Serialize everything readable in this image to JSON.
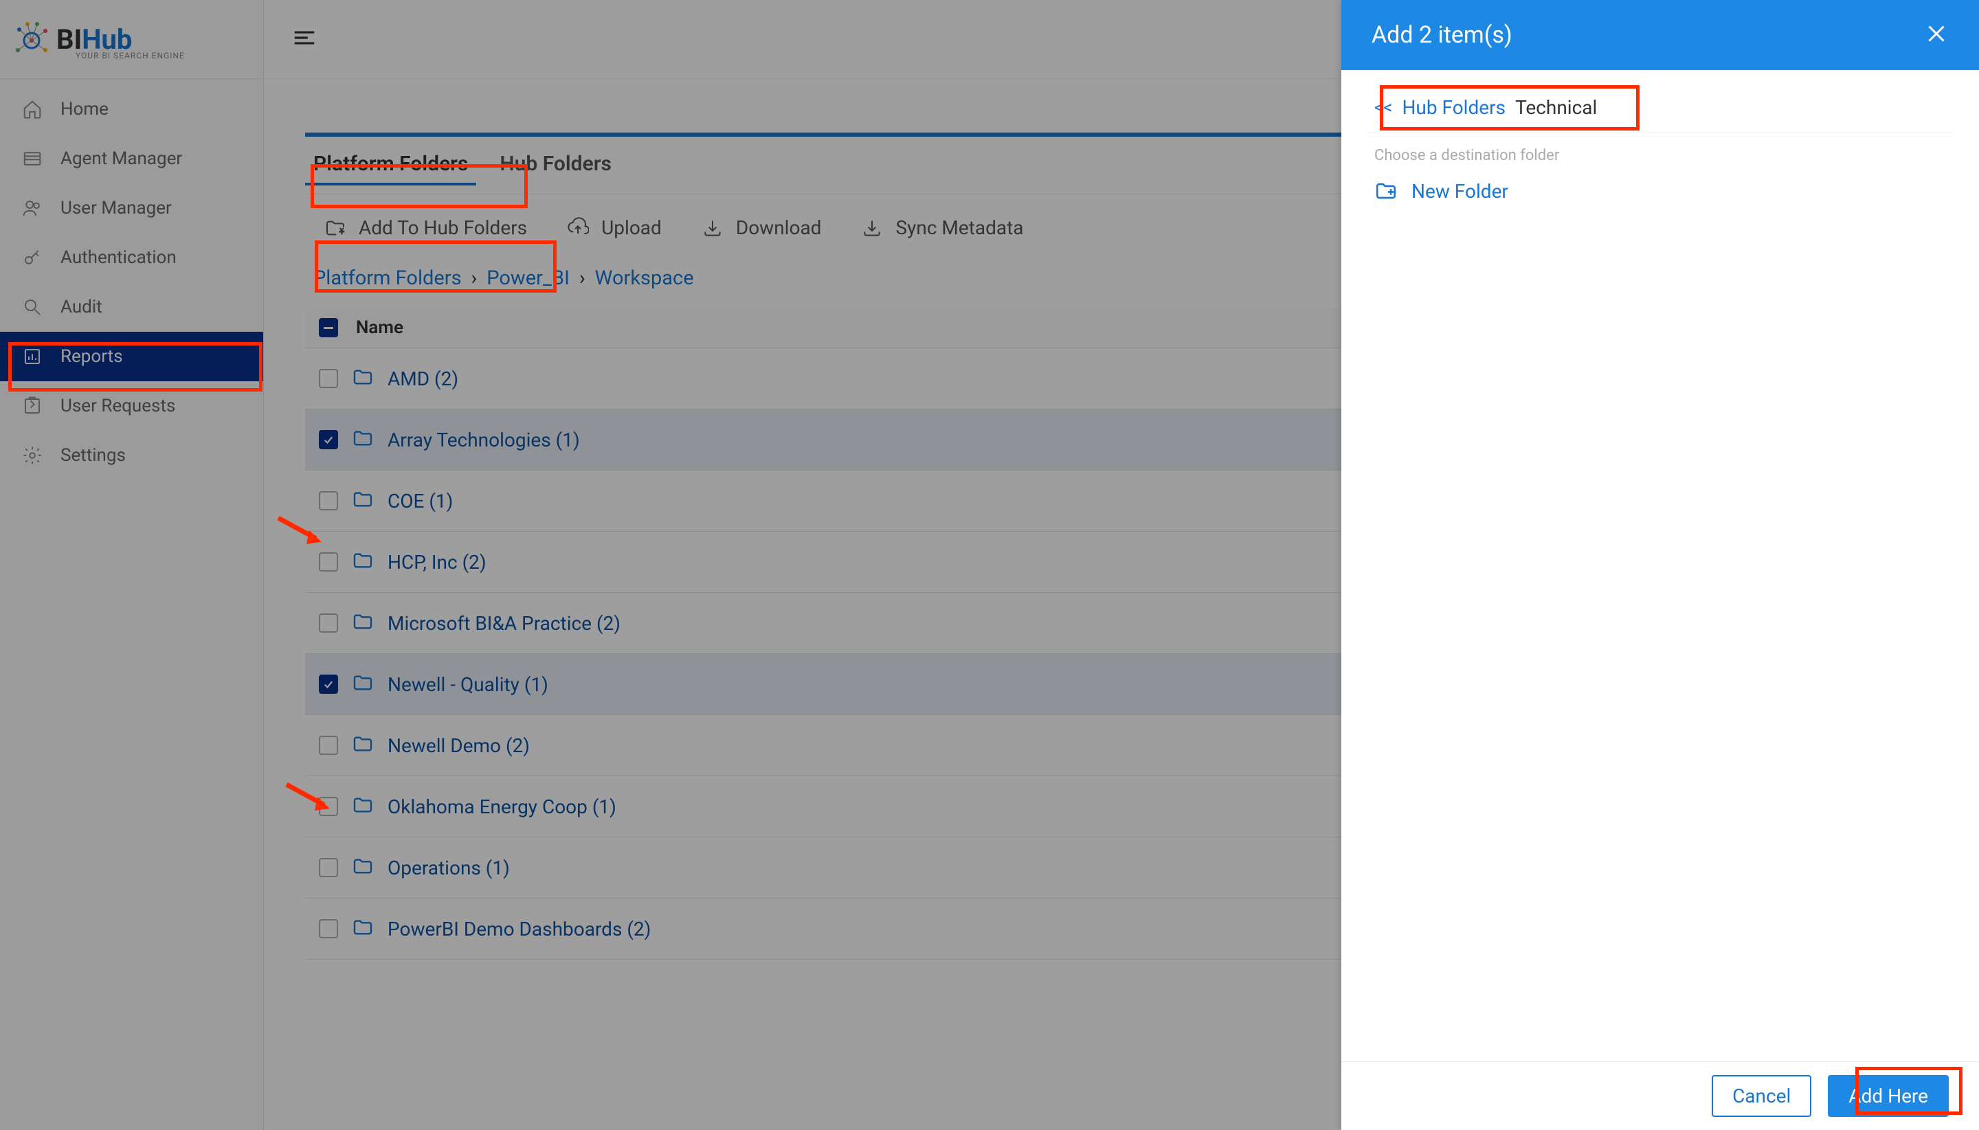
{
  "logo": {
    "bi": "BI",
    "hub": "Hub",
    "sub": "YOUR BI SEARCH ENGINE"
  },
  "sidebar": {
    "items": [
      {
        "label": "Home"
      },
      {
        "label": "Agent Manager"
      },
      {
        "label": "User Manager"
      },
      {
        "label": "Authentication"
      },
      {
        "label": "Audit"
      },
      {
        "label": "Reports"
      },
      {
        "label": "User Requests"
      },
      {
        "label": "Settings"
      }
    ]
  },
  "tabs": {
    "platform": "Platform Folders",
    "hub": "Hub Folders"
  },
  "actions": {
    "add": "Add To Hub Folders",
    "upload": "Upload",
    "download": "Download",
    "sync": "Sync Metadata"
  },
  "breadcrumbs": {
    "a": "Platform Folders",
    "b": "Power_BI",
    "c": "Workspace"
  },
  "table": {
    "header": "Name"
  },
  "rows": [
    {
      "label": "AMD (2)",
      "checked": false
    },
    {
      "label": "Array Technologies (1)",
      "checked": true
    },
    {
      "label": "COE (1)",
      "checked": false
    },
    {
      "label": "HCP, Inc (2)",
      "checked": false
    },
    {
      "label": "Microsoft BI&A Practice (2)",
      "checked": false
    },
    {
      "label": "Newell - Quality (1)",
      "checked": true
    },
    {
      "label": "Newell Demo (2)",
      "checked": false
    },
    {
      "label": "Oklahoma Energy Coop (1)",
      "checked": false
    },
    {
      "label": "Operations (1)",
      "checked": false
    },
    {
      "label": "PowerBI Demo Dashboards (2)",
      "checked": false
    }
  ],
  "panel": {
    "title": "Add 2 item(s)",
    "crumb_link": "Hub Folders",
    "crumb_current": "Technical",
    "hint": "Choose a destination folder",
    "new_folder": "New Folder",
    "cancel": "Cancel",
    "add_here": "Add Here"
  }
}
